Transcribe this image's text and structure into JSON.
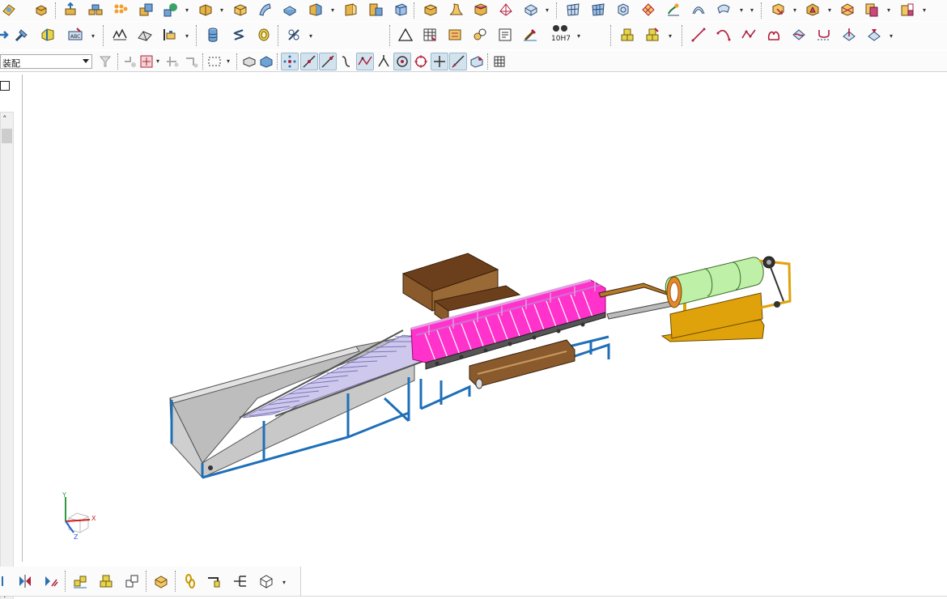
{
  "app": {
    "mode_selector": {
      "value": "装配"
    }
  },
  "toolbars": {
    "row1": [
      "shell-icon",
      "extrude-icon",
      "block-group-icon",
      "pattern-icon",
      "unite-icon",
      "sphere-icon",
      "box-icon",
      "cube-icon",
      "surface-icon",
      "trim-body-icon",
      "shaded-box-icon",
      "split-body-icon",
      "offset-face-icon",
      "sweep-icon",
      "solid-box-icon",
      "thicken-icon",
      "loft-icon",
      "revolve-icon",
      "mesh-surface-icon",
      "grid-surface-icon",
      "blend-icon",
      "fill-surface-icon",
      "curve-network-icon",
      "trim-sheet-icon",
      "section-icon",
      "assembly-icon",
      "component-icon",
      "explode-icon",
      "mate-icon",
      "clone-icon"
    ],
    "row2": [
      "move-icon",
      "hammer-icon",
      "chamfer-icon",
      "text-icon",
      "wave-icon",
      "fold-icon",
      "pattern-feature-icon",
      "cylinder-icon",
      "spring-icon",
      "coin-icon",
      "thread-icon",
      "triangle-icon",
      "table-icon",
      "mark-icon",
      "parts-icon",
      "note-icon",
      "brush-icon",
      "tolerance-icon",
      "stack-icon",
      "stack2-icon",
      "line-icon",
      "arc-icon",
      "polyline-icon",
      "spline-icon",
      "curve-wrap-icon",
      "bridge-icon",
      "section-curve-icon",
      "project-icon"
    ],
    "row2_tolerance_label": "10H7",
    "row3": [
      "filter-icon",
      "select-scope-icon",
      "snap-point-icon",
      "snap-grid-icon",
      "rect-select-icon",
      "box-select-icon",
      "solid-select-icon",
      "snap-end-icon",
      "snap-mid-icon",
      "snap-on-curve-icon",
      "snap-tangent-icon",
      "snap-intersect-icon",
      "snap-perp-icon",
      "snap-center-icon",
      "snap-quadrant-icon",
      "snap-plus-icon",
      "snap-slash-icon",
      "snap-face-icon",
      "grid-icon"
    ],
    "bottom": [
      "assembly-constraint-icon",
      "align-icon",
      "angle-icon",
      "component-array-icon",
      "add-component-icon",
      "move-component-icon",
      "layout-icon",
      "chain-icon",
      "route-icon",
      "network-icon",
      "shaded-component-icon"
    ]
  },
  "triad": {
    "x_label": "X",
    "y_label": "Y",
    "z_label": "Z"
  },
  "colors": {
    "frame_blue": "#1e6fb8",
    "hopper_gray": "#c9c9c9",
    "roller_magenta": "#ff33cc",
    "drum_green": "#bff0a8",
    "drum_frame_orange": "#e0a20b",
    "bin_brown": "#7a4a22",
    "roller_lavender": "#cbc6ea"
  }
}
